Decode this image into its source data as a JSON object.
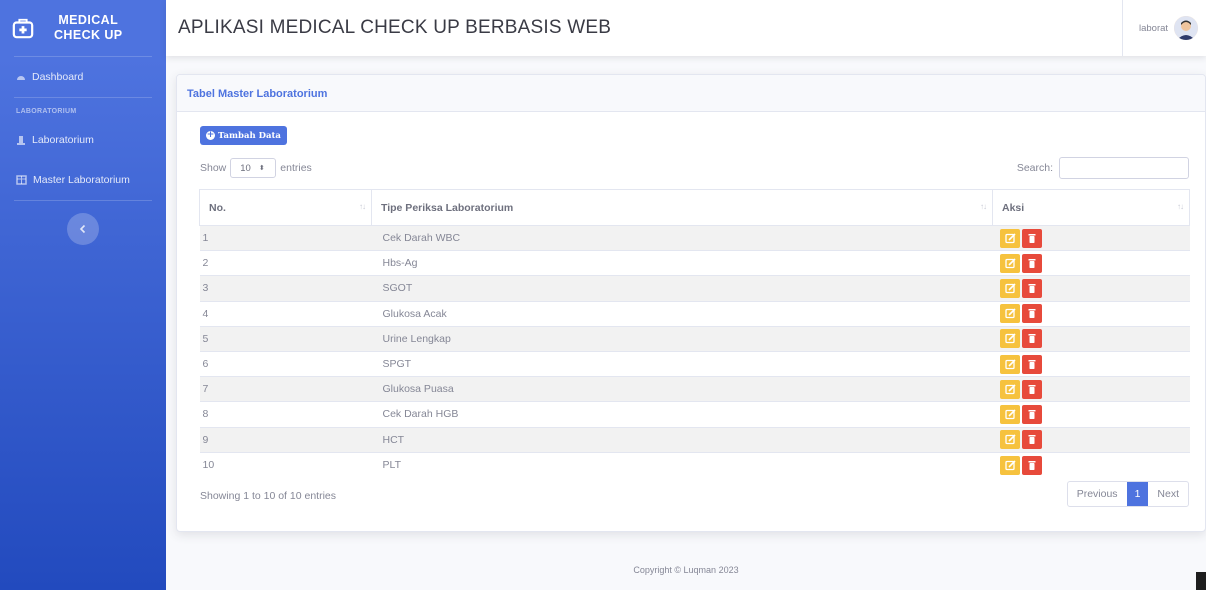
{
  "sidebar": {
    "brand_line1": "MEDICAL",
    "brand_line2": "CHECK UP",
    "dashboard": "Dashboard",
    "heading": "LABORATORIUM",
    "laboratorium": "Laboratorium",
    "master": "Master Laboratorium"
  },
  "topbar": {
    "title": "APLIKASI MEDICAL CHECK UP BERBASIS WEB",
    "user": "laborat"
  },
  "card": {
    "title": "Tabel Master Laboratorium",
    "add_label": "Tambah Data",
    "show_label": "Show",
    "entries_value": "10",
    "entries_label": "entries",
    "search_label": "Search:",
    "columns": [
      "No.",
      "Tipe Periksa Laboratorium",
      "Aksi"
    ],
    "rows": [
      [
        "1",
        "Cek Darah WBC"
      ],
      [
        "2",
        "Hbs-Ag"
      ],
      [
        "3",
        "SGOT"
      ],
      [
        "4",
        "Glukosa Acak"
      ],
      [
        "5",
        "Urine Lengkap"
      ],
      [
        "6",
        "SPGT"
      ],
      [
        "7",
        "Glukosa Puasa"
      ],
      [
        "8",
        "Cek Darah HGB"
      ],
      [
        "9",
        "HCT"
      ],
      [
        "10",
        "PLT"
      ]
    ],
    "info": "Showing 1 to 10 of 10 entries",
    "pager": {
      "prev": "Previous",
      "current": "1",
      "next": "Next"
    }
  },
  "footer": "Copyright © Luqman 2023",
  "colors": {
    "primary": "#4e73df",
    "warning": "#f6c23e",
    "danger": "#e74a3b"
  }
}
